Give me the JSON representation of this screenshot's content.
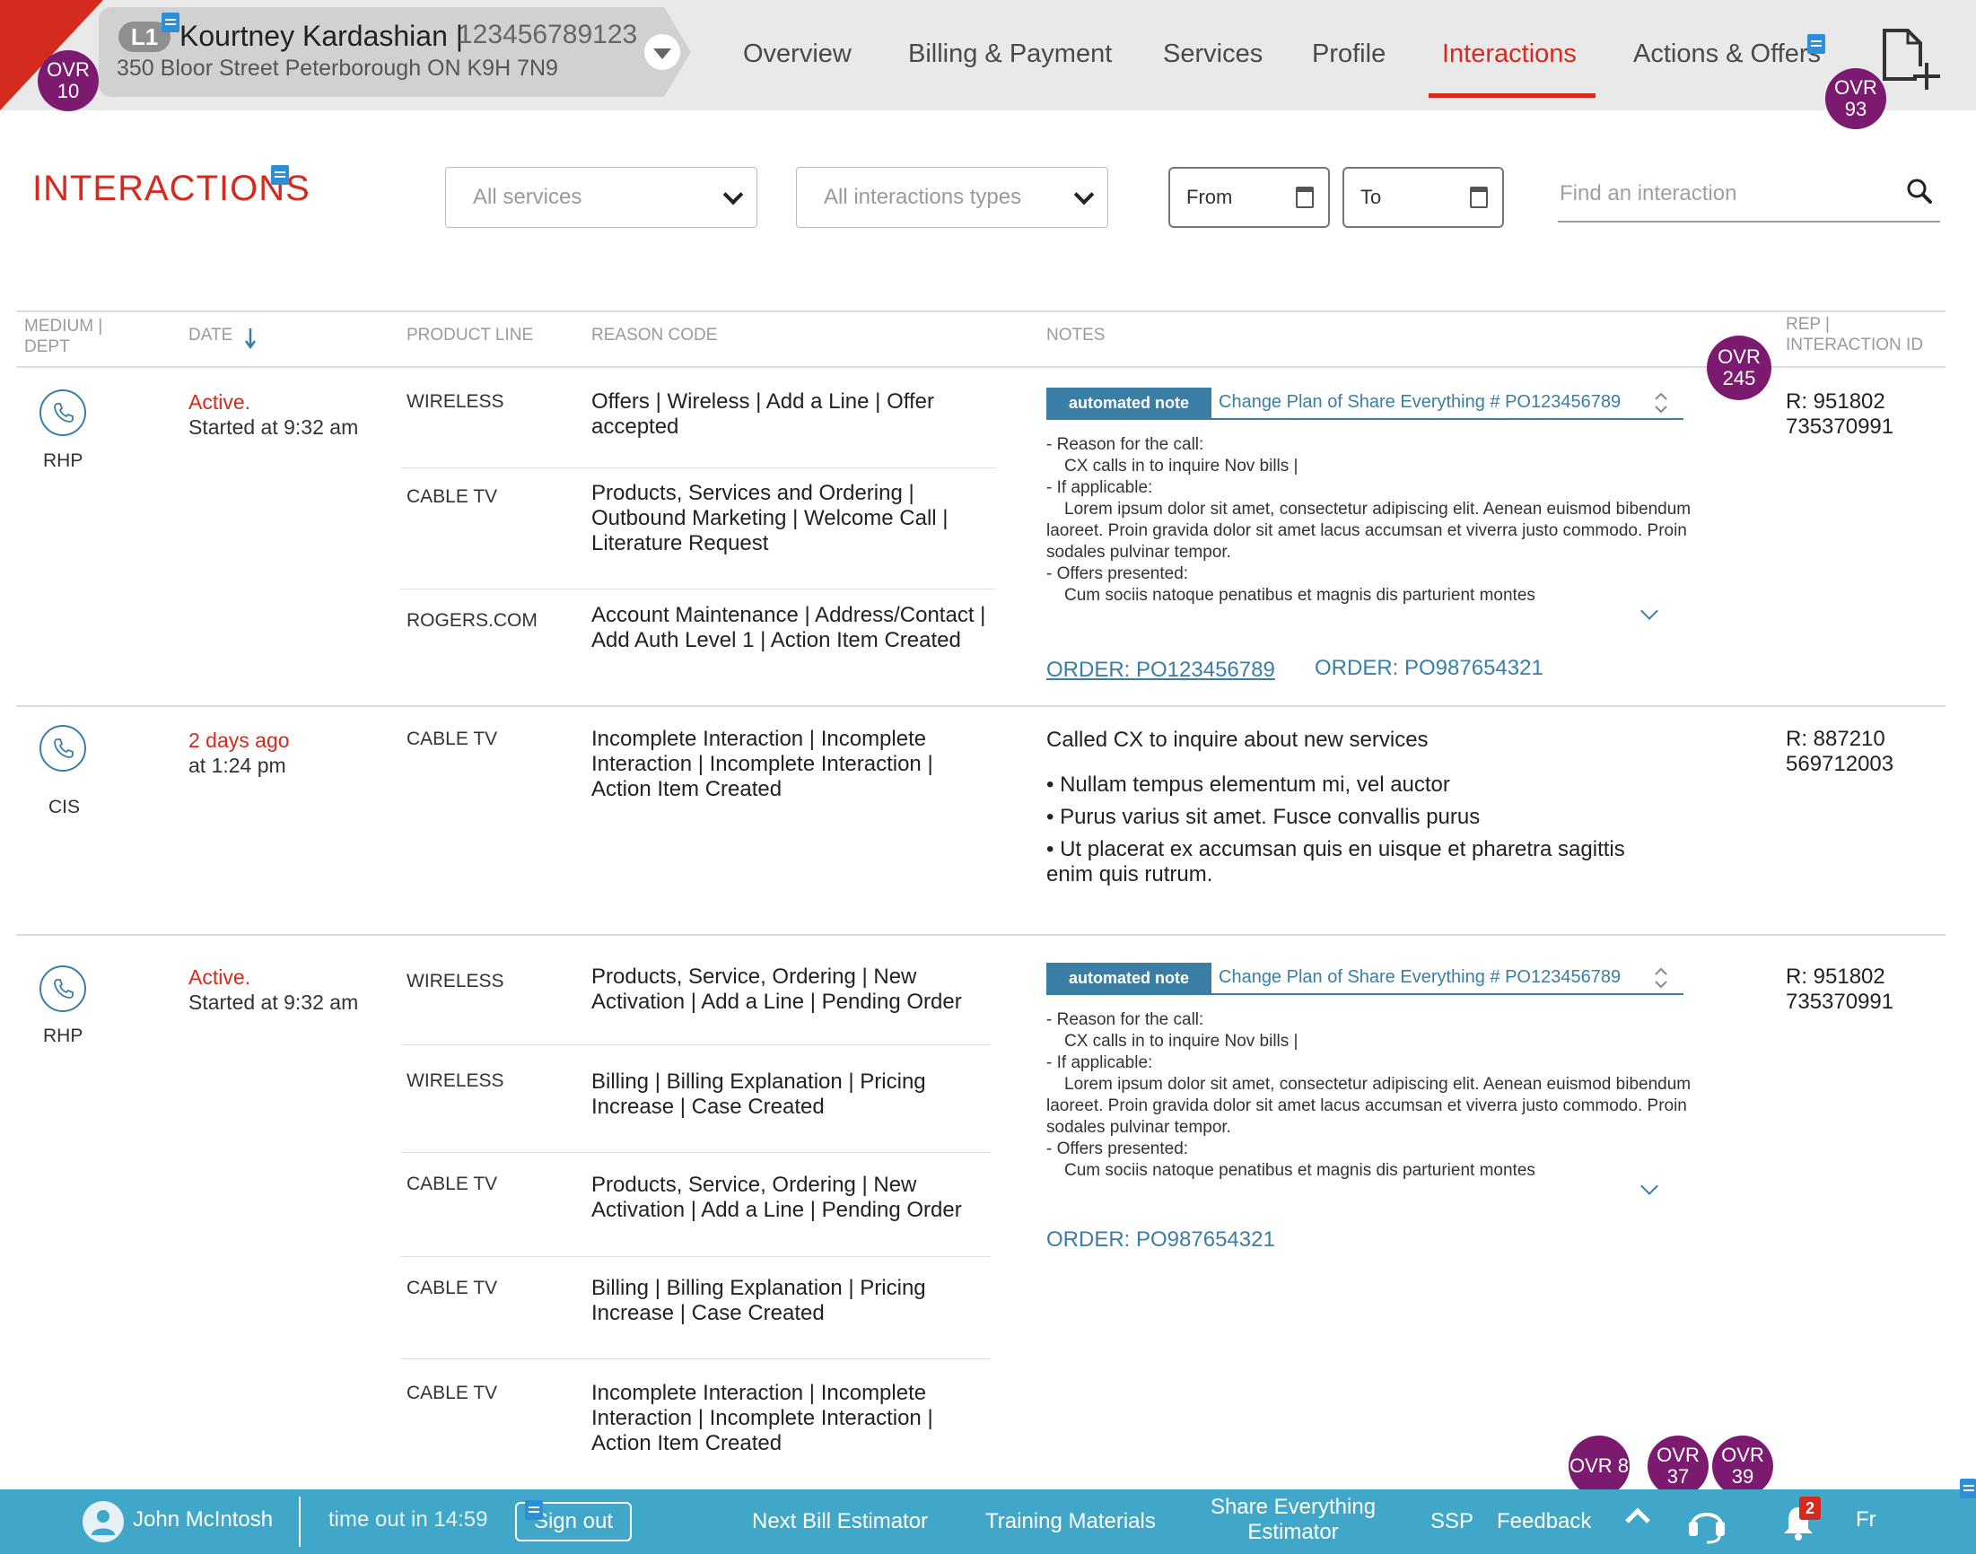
{
  "customer": {
    "level": "L1",
    "name": "Kourtney Kardashian |",
    "account": "123456789123",
    "address": "350 Bloor Street Peterborough ON K9H 7N9"
  },
  "nav": {
    "tabs": [
      "Overview",
      "Billing & Payment",
      "Services",
      "Profile",
      "Interactions",
      "Actions & Offers"
    ],
    "active_tab": "Interactions"
  },
  "overrides": {
    "o10": [
      "OVR",
      "10"
    ],
    "o93": [
      "OVR",
      "93"
    ],
    "o245": [
      "OVR",
      "245"
    ],
    "o8": "OVR 8",
    "o37": [
      "OVR",
      "37"
    ],
    "o39": [
      "OVR",
      "39"
    ]
  },
  "page": {
    "title": "INTERACTIONS"
  },
  "filters": {
    "services": "All services",
    "types": "All interactions types",
    "from": "From",
    "to": "To",
    "search_placeholder": "Find an interaction"
  },
  "table": {
    "headers": {
      "medium_1": "MEDIUM |",
      "medium_2": "DEPT",
      "date": "DATE",
      "product_line": "PRODUCT LINE",
      "reason_code": "REASON CODE",
      "notes": "NOTES",
      "rep_1": "REP |",
      "rep_2": "INTERACTION ID"
    },
    "rows": [
      {
        "dept": "RHP",
        "status": "Active.",
        "time": "Started at 9:32 am",
        "lines": [
          {
            "product": "WIRELESS",
            "reason": "Offers | Wireless | Add a Line | Offer accepted"
          },
          {
            "product": "CABLE TV",
            "reason": "Products, Services and Ordering | Outbound Marketing | Welcome Call | Literature Request"
          },
          {
            "product": "ROGERS.COM",
            "reason": "Account Maintenance | Address/Contact | Add Auth Level 1 | Action Item Created"
          }
        ],
        "note_tag": "automated note",
        "note_link": "Change Plan of Share Everything # PO123456789",
        "note": {
          "l1": "-  Reason for the call:",
          "l2": "CX calls in to inquire Nov bills |",
          "l3": "-  If applicable:",
          "l4": "Lorem ipsum dolor sit amet, consectetur adipiscing elit. Aenean euismod bibendum laoreet. Proin gravida dolor sit amet lacus accumsan et viverra justo commodo. Proin sodales pulvinar tempor.",
          "l5": "-  Offers presented:",
          "l6": "Cum sociis natoque penatibus et magnis dis parturient montes"
        },
        "orders": [
          "ORDER: PO123456789",
          "ORDER: PO987654321"
        ],
        "rep": "R: 951802",
        "interaction_id": "735370991"
      },
      {
        "dept": "CIS",
        "status": "2 days ago",
        "time": "at 1:24 pm",
        "lines": [
          {
            "product": "CABLE TV",
            "reason": "Incomplete Interaction | Incomplete Interaction | Incomplete Interaction | Action Item Created"
          }
        ],
        "note_text": "Called CX to inquire about new services",
        "bullets": [
          "• Nullam tempus elementum mi, vel auctor",
          "• Purus varius sit amet. Fusce convallis purus",
          "• Ut placerat ex accumsan quis en uisque et pharetra sagittis enim quis rutrum."
        ],
        "rep": "R: 887210",
        "interaction_id": "569712003"
      },
      {
        "dept": "RHP",
        "status": "Active.",
        "time": "Started at 9:32 am",
        "lines": [
          {
            "product": "WIRELESS",
            "reason": "Products, Service, Ordering | New Activation | Add a Line | Pending Order"
          },
          {
            "product": "WIRELESS",
            "reason": "Billing | Billing Explanation | Pricing Increase | Case Created"
          },
          {
            "product": "CABLE TV",
            "reason": "Products, Service, Ordering | New Activation | Add a Line | Pending Order"
          },
          {
            "product": "CABLE TV",
            "reason": "Billing | Billing Explanation | Pricing Increase | Case Created"
          },
          {
            "product": "CABLE TV",
            "reason": "Incomplete Interaction | Incomplete Interaction | Incomplete Interaction | Action Item Created"
          }
        ],
        "note_tag": "automated note",
        "note_link": "Change Plan of Share Everything # PO123456789",
        "note": {
          "l1": "-  Reason for the call:",
          "l2": "CX calls in to inquire Nov bills |",
          "l3": "-  If applicable:",
          "l4": "Lorem ipsum dolor sit amet, consectetur adipiscing elit. Aenean euismod bibendum laoreet. Proin gravida dolor sit amet lacus accumsan et viverra justo commodo. Proin sodales pulvinar tempor.",
          "l5": "-  Offers presented:",
          "l6": "Cum sociis natoque penatibus et magnis dis parturient montes"
        },
        "orders": [
          "ORDER: PO987654321"
        ],
        "rep": "R: 951802",
        "interaction_id": "735370991"
      }
    ]
  },
  "footer": {
    "user": "John McIntosh",
    "timeout": "time out in 14:59",
    "signout": "Sign out",
    "links": [
      "Next Bill Estimator",
      "Training Materials",
      "Share Everything",
      "Estimator",
      "SSP",
      "Feedback"
    ],
    "notification_count": "2",
    "language": "Fr"
  },
  "colors": {
    "brand_red": "#d52b1e",
    "accent_blue": "#3a7ea6",
    "footer_blue": "#41a7c9",
    "override_purple": "#7b1a6f"
  }
}
